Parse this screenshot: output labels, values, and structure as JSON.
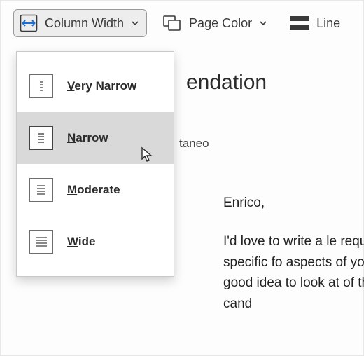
{
  "toolbar": {
    "column_width": {
      "label": "Column Width"
    },
    "page_color": {
      "label": "Page Color"
    },
    "line": {
      "label": "Line"
    }
  },
  "dropdown": {
    "items": [
      {
        "label": "Very Narrow",
        "hotkey_index": 0,
        "selected": false
      },
      {
        "label": "Narrow",
        "hotkey_index": 0,
        "selected": true
      },
      {
        "label": "Moderate",
        "hotkey_index": 0,
        "selected": false
      },
      {
        "label": "Wide",
        "hotkey_index": 0,
        "selected": false
      }
    ]
  },
  "document": {
    "title_fragment": "endation",
    "from_fragment": "taneo",
    "salutation": "Enrico,",
    "body_fragment": "I'd love to write a le require a specific fo aspects of your edu good idea to look at of the types of cand"
  }
}
